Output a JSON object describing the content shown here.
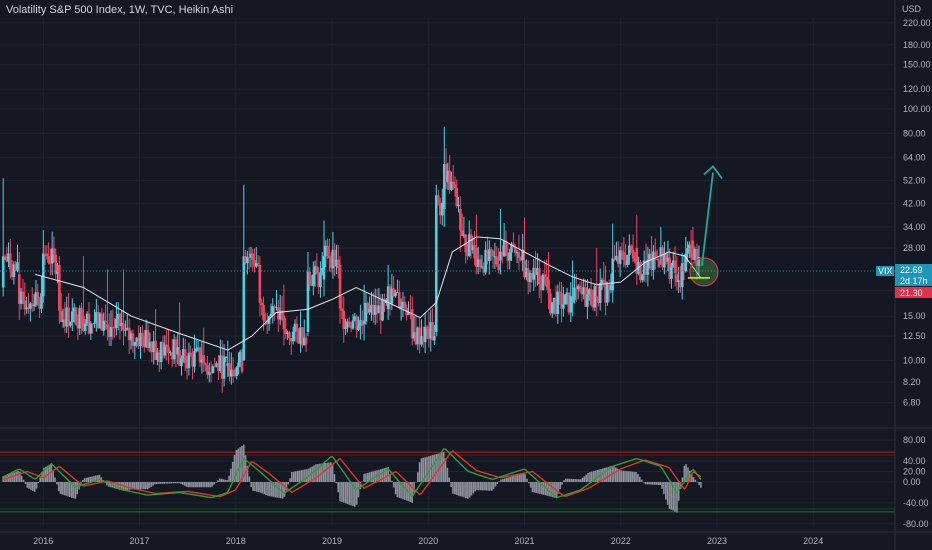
{
  "header": {
    "title": "Volatility S&P 500 Index, 1W, TVC, Heikin Ashi",
    "currency": "USD"
  },
  "colors": {
    "background": "#141823",
    "up": "#4dd0e1",
    "down": "#f0465f",
    "ma": "#e0e3eb",
    "grid": "#1f2430",
    "arrow": "#26a69a",
    "osc_green": "#2e9e36",
    "osc_red": "#e2342b",
    "osc_hist": "#9a9ea8"
  },
  "price_labels": {
    "symbol": "VIX",
    "last": "22.69",
    "countdown": "2d 17h",
    "ma_value": "21.30"
  },
  "chart_data": [
    {
      "type": "candlestick",
      "title": "Volatility S&P 500 Index, 1W, TVC, Heikin Ashi",
      "y_scale": "log",
      "ylim": [
        5.8,
        230
      ],
      "y_ticks": [
        "6.80",
        "8.20",
        "10.00",
        "12.50",
        "15.00",
        "19.00",
        "28.00",
        "34.00",
        "42.00",
        "52.00",
        "64.00",
        "80.00",
        "100.00",
        "120.00",
        "150.00",
        "180.00",
        "220.00"
      ],
      "x_ticks": [
        "2016",
        "2017",
        "2018",
        "2019",
        "2020",
        "2021",
        "2022",
        "2023",
        "2024"
      ],
      "series": [
        {
          "name": "VIX",
          "kind": "heikin-ashi",
          "points": [
            [
              "2015-08",
              19.5,
              53.0,
              18.0,
              26.0
            ],
            [
              "2015-10",
              22.0,
              27.0,
              14.5,
              17.0
            ],
            [
              "2016-01",
              18.0,
              33.0,
              17.0,
              27.0
            ],
            [
              "2016-03",
              24.0,
              26.0,
              14.0,
              15.0
            ],
            [
              "2016-06",
              15.0,
              26.0,
              13.0,
              14.5
            ],
            [
              "2016-09",
              14.0,
              23.0,
              12.0,
              13.5
            ],
            [
              "2016-11",
              14.0,
              23.0,
              11.5,
              12.5
            ],
            [
              "2017-03",
              12.0,
              16.0,
              10.5,
              11.0
            ],
            [
              "2017-06",
              11.0,
              17.0,
              9.5,
              10.0
            ],
            [
              "2017-09",
              10.5,
              13.5,
              9.0,
              9.5
            ],
            [
              "2017-12",
              9.5,
              12.0,
              8.6,
              9.5
            ],
            [
              "2018-02",
              10.0,
              50.0,
              10.0,
              27.0
            ],
            [
              "2018-04",
              24.0,
              26.0,
              15.0,
              16.0
            ],
            [
              "2018-07",
              15.0,
              20.0,
              11.5,
              12.5
            ],
            [
              "2018-10",
              13.0,
              27.0,
              12.5,
              22.0
            ],
            [
              "2018-12",
              21.0,
              36.0,
              18.0,
              28.0
            ],
            [
              "2019-02",
              24.0,
              26.0,
              14.0,
              15.0
            ],
            [
              "2019-05",
              14.0,
              20.0,
              12.0,
              15.5
            ],
            [
              "2019-08",
              16.0,
              24.0,
              14.5,
              18.5
            ],
            [
              "2019-11",
              16.0,
              18.0,
              11.5,
              12.5
            ],
            [
              "2020-02",
              13.0,
              50.0,
              12.5,
              42.0
            ],
            [
              "2020-03",
              40.0,
              85.0,
              34.0,
              58.0
            ],
            [
              "2020-05",
              40.0,
              45.0,
              27.0,
              30.0
            ],
            [
              "2020-07",
              28.0,
              38.0,
              22.0,
              25.0
            ],
            [
              "2020-10",
              25.0,
              40.0,
              22.0,
              28.0
            ],
            [
              "2021-01",
              25.0,
              37.0,
              21.0,
              22.0
            ],
            [
              "2021-04",
              21.0,
              27.0,
              16.0,
              17.0
            ],
            [
              "2021-07",
              17.0,
              25.0,
              15.0,
              18.0
            ],
            [
              "2021-10",
              18.0,
              28.0,
              15.0,
              19.0
            ],
            [
              "2021-12",
              19.0,
              35.0,
              17.0,
              24.0
            ],
            [
              "2022-03",
              28.0,
              38.0,
              20.0,
              22.0
            ],
            [
              "2022-06",
              26.0,
              34.0,
              24.0,
              26.0
            ],
            [
              "2022-08",
              22.0,
              26.0,
              19.0,
              20.0
            ],
            [
              "2022-10",
              30.0,
              34.0,
              25.0,
              28.0
            ],
            [
              "2022-11",
              24.0,
              26.0,
              21.0,
              22.7
            ]
          ]
        },
        {
          "name": "MA",
          "kind": "line",
          "points": [
            [
              "2015-12",
              22.0
            ],
            [
              "2016-06",
              19.5
            ],
            [
              "2016-12",
              15.0
            ],
            [
              "2017-06",
              12.8
            ],
            [
              "2017-12",
              11.0
            ],
            [
              "2018-03",
              12.5
            ],
            [
              "2018-06",
              15.5
            ],
            [
              "2018-10",
              16.0
            ],
            [
              "2019-01",
              17.5
            ],
            [
              "2019-04",
              19.5
            ],
            [
              "2019-08",
              17.0
            ],
            [
              "2019-12",
              14.8
            ],
            [
              "2020-02",
              17.0
            ],
            [
              "2020-04",
              27.0
            ],
            [
              "2020-07",
              31.0
            ],
            [
              "2020-10",
              30.5
            ],
            [
              "2021-01",
              27.0
            ],
            [
              "2021-04",
              24.0
            ],
            [
              "2021-07",
              21.5
            ],
            [
              "2021-10",
              20.0
            ],
            [
              "2022-01",
              20.5
            ],
            [
              "2022-04",
              24.5
            ],
            [
              "2022-07",
              27.0
            ],
            [
              "2022-09",
              26.0
            ],
            [
              "2022-11",
              21.3
            ]
          ]
        }
      ],
      "annotations": {
        "arrow_target": [
          "2023-01",
          58.0
        ],
        "circle_center": [
          "2022-11",
          22.5
        ],
        "support_line_y": 21.3,
        "horizontal_price_line": 22.69
      }
    },
    {
      "type": "line",
      "ylim": [
        -86,
        86
      ],
      "y_ticks": [
        "80.00",
        "40.00",
        "20.00",
        "0.00",
        "-40.00",
        "-80.00"
      ],
      "threshold_upper": 57,
      "threshold_lower": -57,
      "series": [
        {
          "name": "fast",
          "color": "#2e9e36",
          "points": [
            [
              "2015-08",
              10
            ],
            [
              "2015-10",
              25
            ],
            [
              "2015-12",
              5
            ],
            [
              "2016-02",
              35
            ],
            [
              "2016-05",
              -10
            ],
            [
              "2016-08",
              5
            ],
            [
              "2016-11",
              -15
            ],
            [
              "2017-02",
              -25
            ],
            [
              "2017-06",
              -20
            ],
            [
              "2017-10",
              -30
            ],
            [
              "2017-12",
              -20
            ],
            [
              "2018-02",
              45
            ],
            [
              "2018-04",
              20
            ],
            [
              "2018-07",
              -22
            ],
            [
              "2018-10",
              10
            ],
            [
              "2019-01",
              50
            ],
            [
              "2019-04",
              -15
            ],
            [
              "2019-08",
              25
            ],
            [
              "2019-11",
              -28
            ],
            [
              "2020-03",
              65
            ],
            [
              "2020-06",
              20
            ],
            [
              "2020-09",
              5
            ],
            [
              "2021-01",
              25
            ],
            [
              "2021-05",
              -30
            ],
            [
              "2021-08",
              -15
            ],
            [
              "2021-12",
              30
            ],
            [
              "2022-03",
              45
            ],
            [
              "2022-06",
              30
            ],
            [
              "2022-08",
              -20
            ],
            [
              "2022-10",
              25
            ],
            [
              "2022-11",
              5
            ]
          ]
        },
        {
          "name": "slow",
          "color": "#e2342b",
          "points": [
            [
              "2015-08",
              5
            ],
            [
              "2015-11",
              20
            ],
            [
              "2016-01",
              8
            ],
            [
              "2016-03",
              30
            ],
            [
              "2016-06",
              -8
            ],
            [
              "2016-09",
              2
            ],
            [
              "2016-12",
              -12
            ],
            [
              "2017-03",
              -22
            ],
            [
              "2017-07",
              -18
            ],
            [
              "2017-11",
              -28
            ],
            [
              "2018-01",
              -15
            ],
            [
              "2018-03",
              40
            ],
            [
              "2018-05",
              18
            ],
            [
              "2018-08",
              -20
            ],
            [
              "2018-11",
              8
            ],
            [
              "2019-02",
              45
            ],
            [
              "2019-05",
              -12
            ],
            [
              "2019-09",
              20
            ],
            [
              "2019-12",
              -25
            ],
            [
              "2020-04",
              60
            ],
            [
              "2020-07",
              22
            ],
            [
              "2020-10",
              8
            ],
            [
              "2021-02",
              20
            ],
            [
              "2021-06",
              -28
            ],
            [
              "2021-09",
              -12
            ],
            [
              "2022-01",
              25
            ],
            [
              "2022-04",
              42
            ],
            [
              "2022-07",
              28
            ],
            [
              "2022-09",
              -15
            ],
            [
              "2022-10",
              20
            ],
            [
              "2022-11",
              10
            ]
          ]
        }
      ]
    }
  ]
}
